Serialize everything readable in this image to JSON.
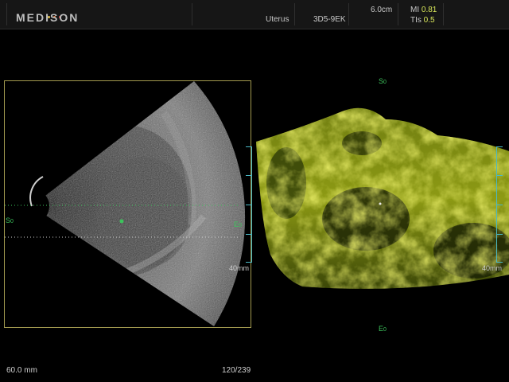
{
  "header": {
    "brand": "MEDISON",
    "preset": "Uterus",
    "probe": "3D5-9EK",
    "depth": "6.0cm",
    "mi_label": "MI",
    "mi_value": "0.81",
    "tis_label": "TIs",
    "tis_value": "0.5"
  },
  "view2d": {
    "start_marker": "S",
    "start_sub": "0",
    "end_marker": "E",
    "end_sub": "0",
    "scale_label": "40mm"
  },
  "view3d": {
    "top_marker": "S",
    "top_sub": "0",
    "bottom_marker": "E",
    "bottom_sub": "0",
    "scale_label": "40mm"
  },
  "footer": {
    "field_of_view": "60.0 mm",
    "frame_counter": "120/239"
  },
  "colors": {
    "marker_green": "#3cc35c",
    "scale_cyan": "#4ab9c6",
    "frame_yellow": "#a29a4f",
    "render_yellow": "#d8e228"
  },
  "icons": {
    "logo_dots": "three-colored-dots"
  }
}
